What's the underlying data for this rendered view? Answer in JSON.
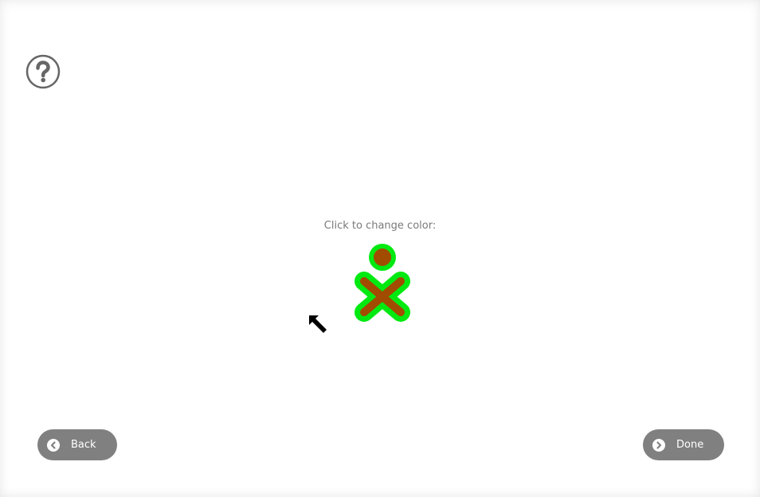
{
  "prompt": {
    "text": "Click to change color:"
  },
  "buttons": {
    "back_label": "Back",
    "done_label": "Done"
  },
  "icons": {
    "help": "help-icon",
    "xo": "xo-buddy-icon",
    "back": "back-arrow-icon",
    "done": "forward-arrow-icon",
    "cursor": "mouse-pointer-icon"
  },
  "colors": {
    "xo_stroke": "#00ea11",
    "xo_fill": "#a14c00",
    "button_bg": "#808080",
    "button_text": "#ffffff",
    "help_icon": "#666666"
  }
}
